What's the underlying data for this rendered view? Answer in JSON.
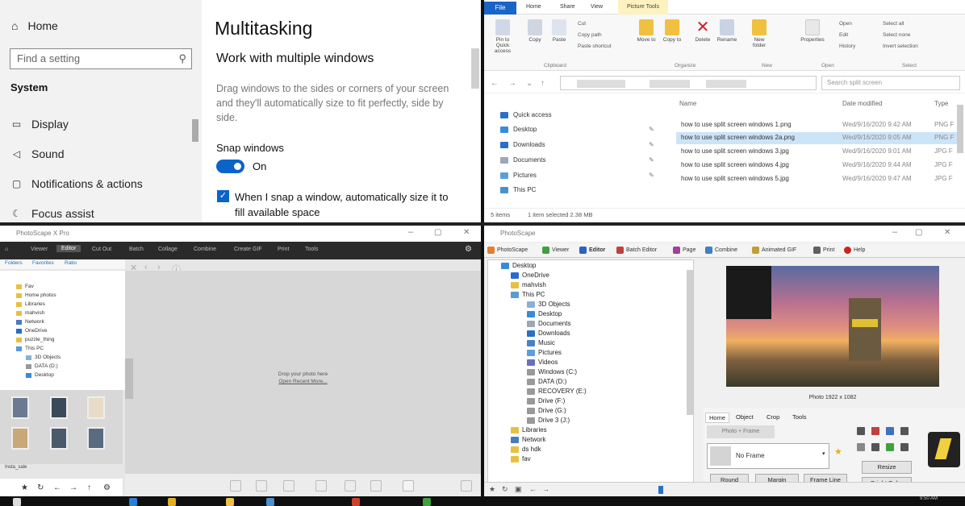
{
  "settings": {
    "home": "Home",
    "search_placeholder": "Find a setting",
    "section": "System",
    "nav": [
      "Display",
      "Sound",
      "Notifications & actions",
      "Focus assist"
    ],
    "title": "Multitasking",
    "subtitle": "Work with multiple windows",
    "description": "Drag windows to the sides or corners of your screen and they'll automatically size to fit perfectly, side by side.",
    "snap_label": "Snap windows",
    "toggle_state": "On",
    "checkbox_label": "When I snap a window, automatically size it to fill available space"
  },
  "explorer": {
    "tabs": {
      "file": "File",
      "home": "Home",
      "share": "Share",
      "view": "View",
      "manage": "Manage",
      "picture_tools": "Picture Tools"
    },
    "ribbon": {
      "pin": "Pin to Quick access",
      "copy": "Copy",
      "paste": "Paste",
      "cut": "Cut",
      "copy_path": "Copy path",
      "paste_shortcut": "Paste shortcut",
      "move_to": "Move to",
      "copy_to": "Copy to",
      "delete": "Delete",
      "rename": "Rename",
      "new_folder": "New folder",
      "properties": "Properties",
      "open": "Open",
      "edit": "Edit",
      "history": "History",
      "select_all": "Select all",
      "select_none": "Select none",
      "invert_selection": "Invert selection",
      "groups": [
        "Clipboard",
        "Organize",
        "New",
        "Open",
        "Select"
      ]
    },
    "search_placeholder": "Search split screen",
    "nav_items": [
      "Quick access",
      "Desktop",
      "Downloads",
      "Documents",
      "Pictures",
      "This PC"
    ],
    "columns": [
      "Name",
      "Date modified",
      "Type"
    ],
    "files": [
      {
        "name": "how to use split screen windows 1.png",
        "date": "Wed/9/16/2020 9:42 AM",
        "type": "PNG F"
      },
      {
        "name": "how to use split screen windows 2a.png",
        "date": "Wed/9/16/2020 9:05 AM",
        "type": "PNG F"
      },
      {
        "name": "how to use split screen windows 3.jpg",
        "date": "Wed/9/16/2020 9:01 AM",
        "type": "JPG F"
      },
      {
        "name": "how to use split screen windows 4.jpg",
        "date": "Wed/9/16/2020 9:44 AM",
        "type": "JPG F"
      },
      {
        "name": "how to use split screen windows 5.jpg",
        "date": "Wed/9/16/2020 9:47 AM",
        "type": "JPG F"
      }
    ],
    "status": {
      "items": "5 items",
      "selected": "1 item selected  2.38 MB"
    }
  },
  "psx": {
    "title": "PhotoScape X Pro",
    "tabs": [
      "Viewer",
      "Editor",
      "Cut Out",
      "Batch",
      "Collage",
      "Combine",
      "Create GIF",
      "Print",
      "Tools"
    ],
    "active_tab": "Editor",
    "subtabs": [
      "Folders",
      "Favorites",
      "Ratio"
    ],
    "tree": [
      "Fav",
      "Home photos",
      "Libraries",
      "mahvish",
      "Network",
      "OneDrive",
      "puzzle_thing",
      "This PC",
      "3D Objects",
      "DATA (D:)",
      "Desktop"
    ],
    "drop_text": "Drop your photo here",
    "drop_links": "Open  Recent  More...",
    "thumb_label": "Insta_sale"
  },
  "ps": {
    "title": "PhotoScape",
    "tabs": [
      "PhotoScape",
      "Viewer",
      "Editor",
      "Batch Editor",
      "Page",
      "Combine",
      "Animated GIF",
      "Print",
      "Help"
    ],
    "tree": [
      "Desktop",
      "OneDrive",
      "mahvish",
      "This PC",
      "3D Objects",
      "Desktop",
      "Documents",
      "Downloads",
      "Music",
      "Pictures",
      "Videos",
      "Windows (C:)",
      "DATA (D:)",
      "RECOVERY (E:)",
      "Drive (F:)",
      "Drive (G:)",
      "Drive 3 (J:)",
      "Libraries",
      "Network",
      "ds hdk",
      "fav"
    ],
    "photo_info": "Photo 1922 x 1082",
    "edit_tabs": [
      "Home",
      "Object",
      "Crop",
      "Tools"
    ],
    "frame_label": "Photo + Frame",
    "frame_value": "No Frame",
    "buttons": [
      "Round",
      "Margin",
      "Frame Line",
      "Resize",
      "Bright,Color"
    ]
  },
  "taskbar": {
    "time": "9:50 AM"
  }
}
